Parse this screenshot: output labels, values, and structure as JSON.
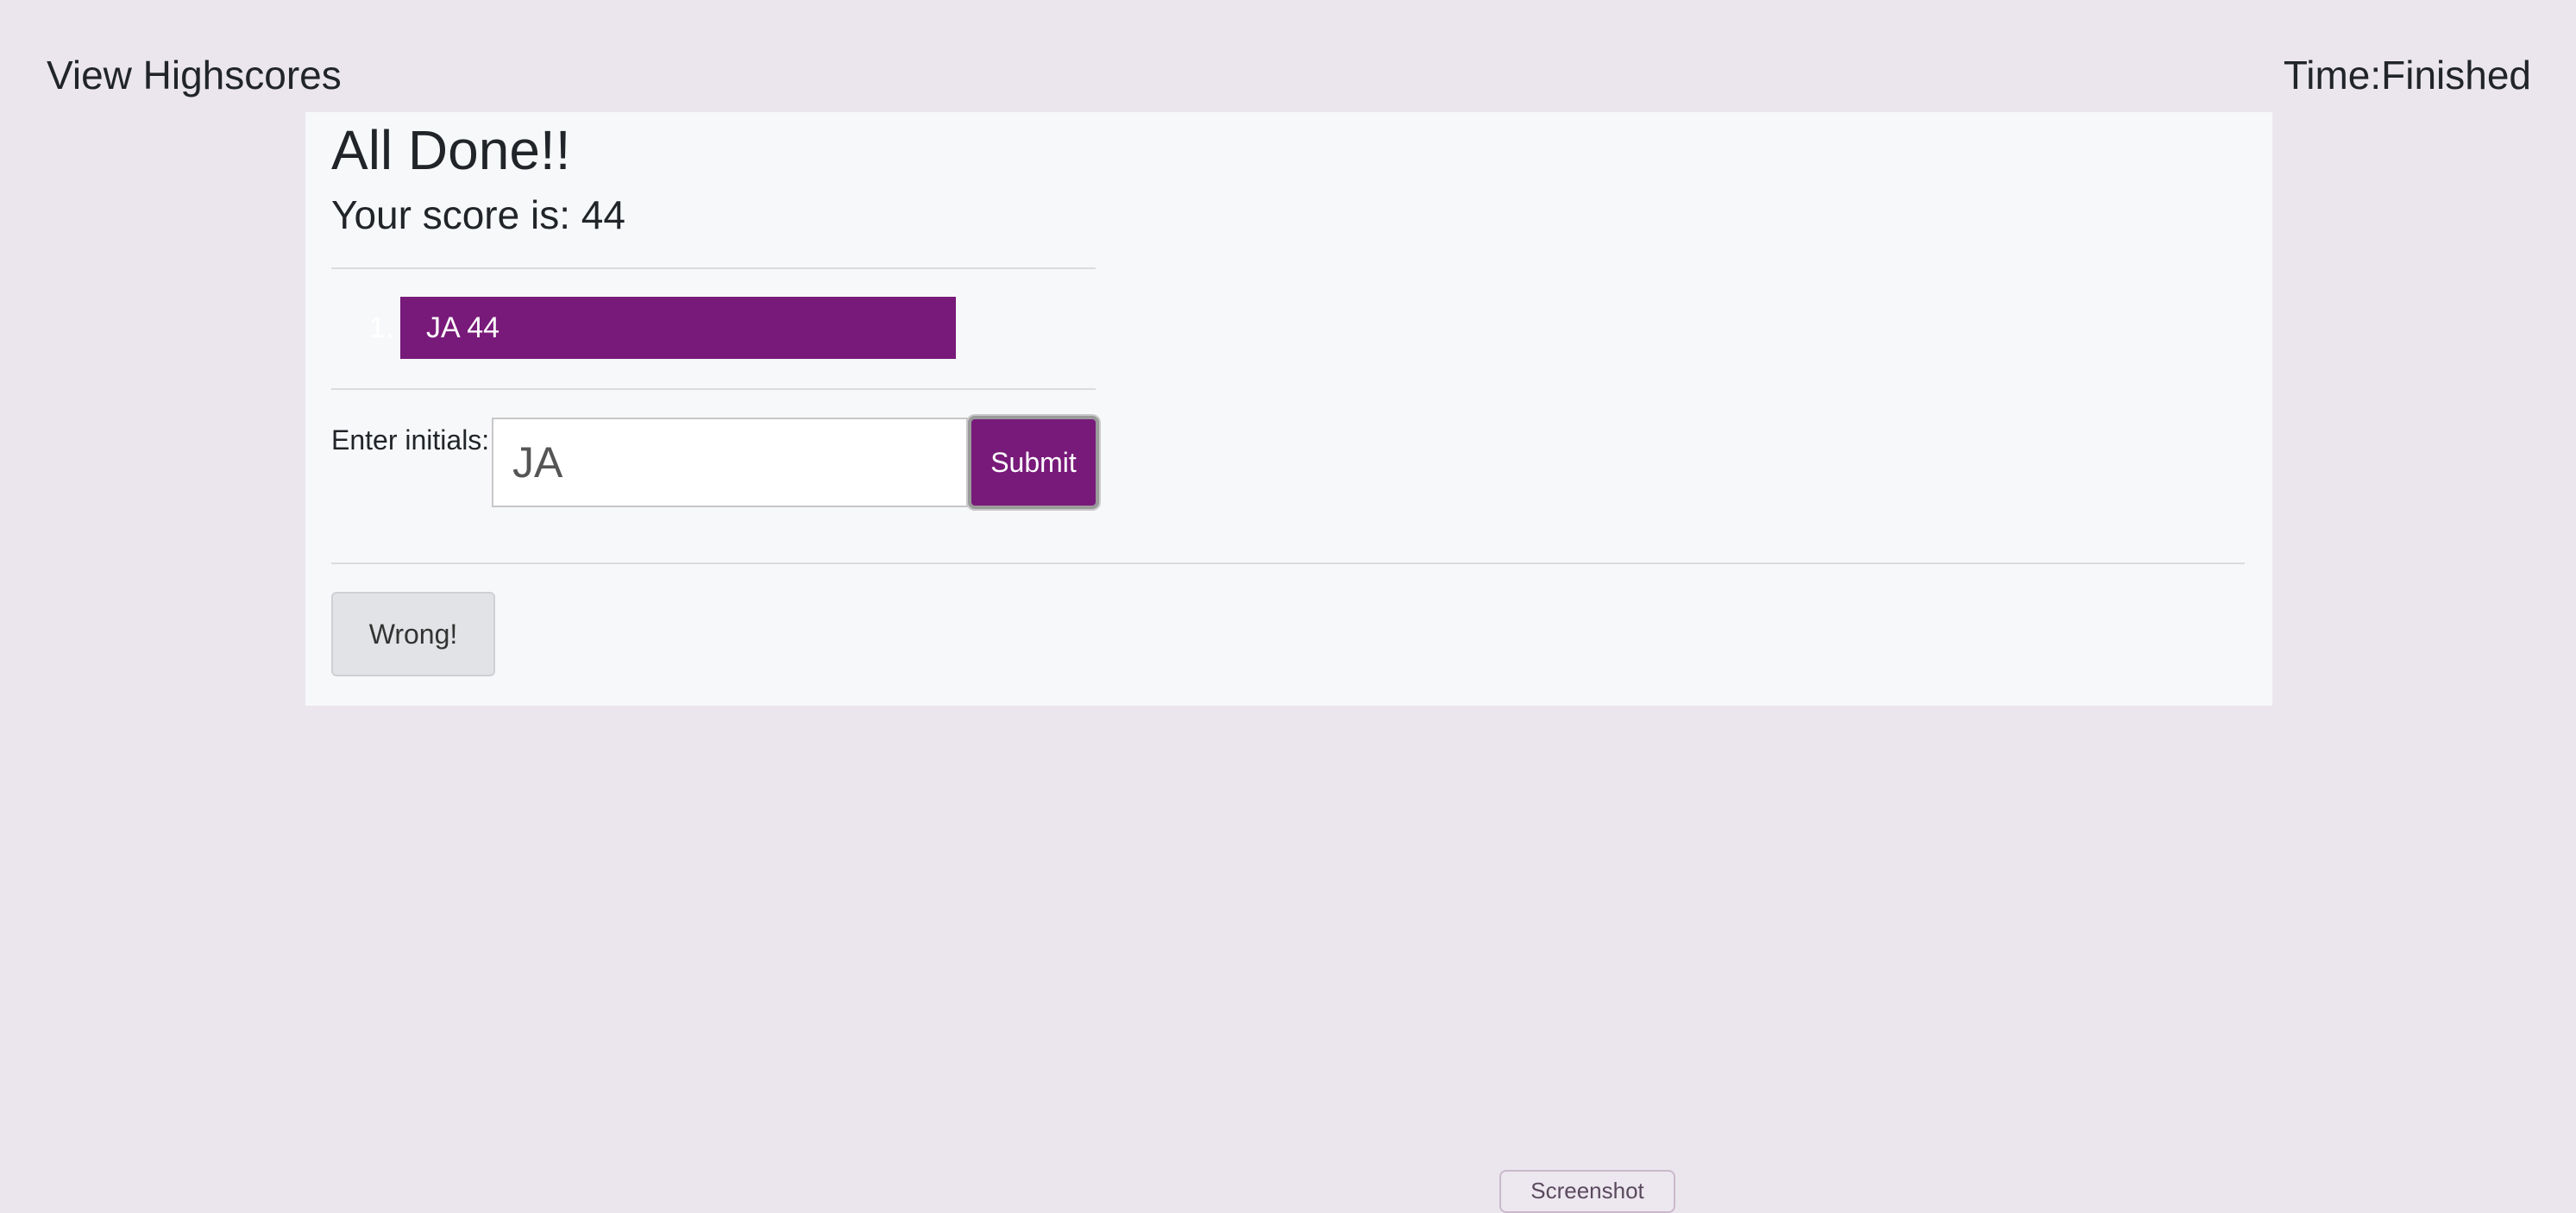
{
  "header": {
    "highscores_link": "View Highscores",
    "timer_text": "Time:Finished"
  },
  "result": {
    "title": "All Done!!",
    "score_text": "Your score is: 44"
  },
  "highscores": {
    "items": [
      {
        "rank": "1.",
        "text": "JA 44"
      }
    ]
  },
  "form": {
    "label": "Enter initials:",
    "initials_value": "JA",
    "submit_label": "Submit"
  },
  "feedback": {
    "label": "Wrong!"
  },
  "footer": {
    "screenshot_label": "Screenshot"
  },
  "colors": {
    "page_background": "#ebe6ee",
    "card_background": "#f7f8fa",
    "accent": "#781a7a"
  }
}
